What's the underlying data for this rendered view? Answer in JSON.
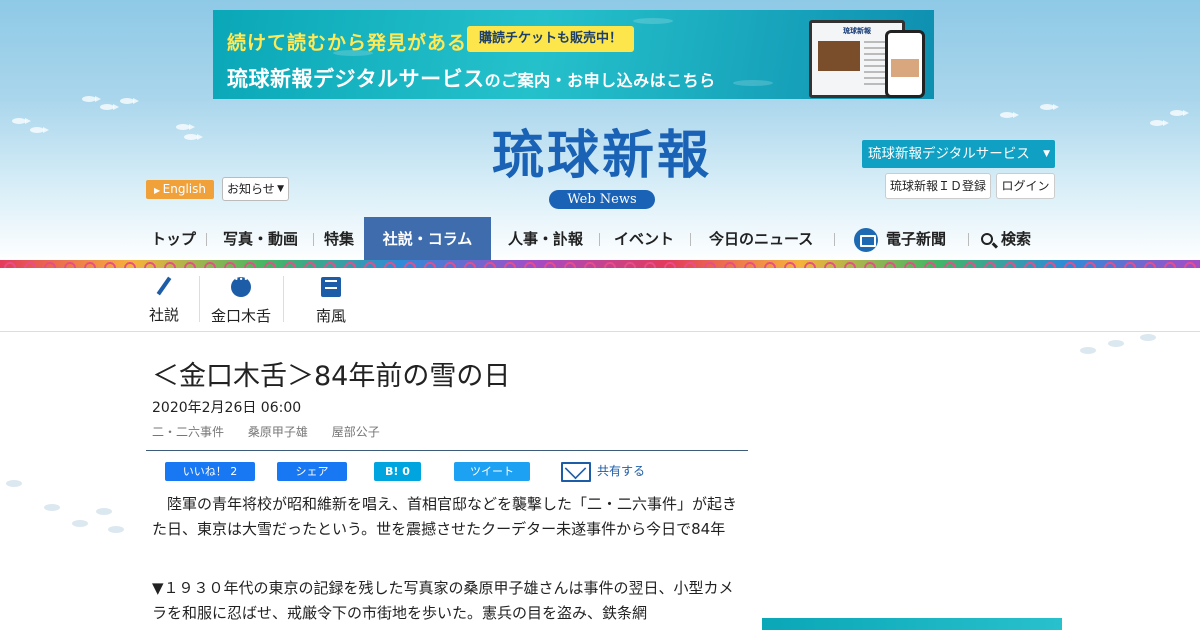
{
  "banner": {
    "line1": "続けて読むから発見がある",
    "ticket": "購読チケットも販売中！",
    "line2_main": "琉球新報デジタルサービス",
    "line2_small": "のご案内・お申し込みはこちら",
    "device_title": "琉球新報"
  },
  "header": {
    "english": "English",
    "notice": "お知らせ",
    "logo": "琉球新報",
    "logo_sub": "Web News",
    "digital_service": "琉球新報デジタルサービス",
    "id_register": "琉球新報ＩＤ登録",
    "login": "ログイン"
  },
  "nav": {
    "items": [
      {
        "label": "トップ"
      },
      {
        "label": "写真・動画"
      },
      {
        "label": "特集"
      },
      {
        "label": "社説・コラム"
      },
      {
        "label": "人事・訃報"
      },
      {
        "label": "イベント"
      },
      {
        "label": "今日のニュース"
      },
      {
        "label": "電子新聞"
      },
      {
        "label": "検索"
      }
    ],
    "active": "社説・コラム"
  },
  "subnav": {
    "items": [
      {
        "label": "社説",
        "icon": "pen-icon"
      },
      {
        "label": "金口木舌",
        "icon": "speech-bubble-icon"
      },
      {
        "label": "南風",
        "icon": "note-icon"
      }
    ]
  },
  "article": {
    "title": "＜金口木舌＞84年前の雪の日",
    "date": "2020年2月26日 06:00",
    "tags": [
      "二・二六事件",
      "桑原甲子雄",
      "屋部公子"
    ],
    "share": {
      "like": "いいね！ 2",
      "facebook": "シェア",
      "hatena": "B! 0",
      "tweet": "ツイート",
      "mail": "共有する"
    },
    "paragraph1": "　陸軍の青年将校が昭和維新を唱え、首相官邸などを襲撃した「二・二六事件」が起きた日、東京は大雪だったという。世を震撼させたクーデター未遂事件から今日で84年",
    "paragraph2": "▼１９３０年代の東京の記録を残した写真家の桑原甲子雄さんは事件の翌日、小型カメラを和服に忍ばせ、戒厳令下の市街地を歩いた。憲兵の目を盗み、鉄条網"
  },
  "colors": {
    "brand_blue": "#1a62b5",
    "nav_active": "#3e6cac",
    "english_orange": "#f0a13a",
    "digital_teal": "#10a0c3"
  }
}
